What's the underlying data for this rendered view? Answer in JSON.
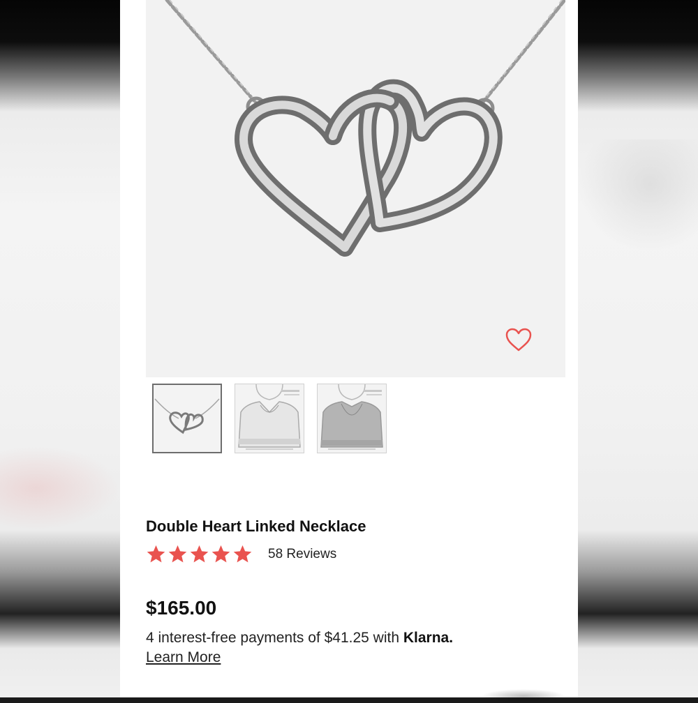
{
  "product": {
    "title": "Double Heart Linked Necklace",
    "rating_stars": 5,
    "reviews_label": "58 Reviews",
    "price": "$165.00",
    "installments_text": "4 interest-free payments of $41.25 with ",
    "installments_brand": "Klarna.",
    "learn_more_label": "Learn More"
  },
  "gallery": {
    "hero_icon": "necklace-double-heart-image",
    "favorite_icon": "heart-outline-icon",
    "thumbnails": [
      {
        "icon": "necklace-thumbnail",
        "active": true
      },
      {
        "icon": "model-wearing-necklace-thumbnail",
        "active": false
      },
      {
        "icon": "model-wearing-necklace-thumbnail",
        "active": false
      }
    ]
  },
  "colors": {
    "star": "#e9534f",
    "favorite": "#e9534f",
    "text": "#111111"
  }
}
